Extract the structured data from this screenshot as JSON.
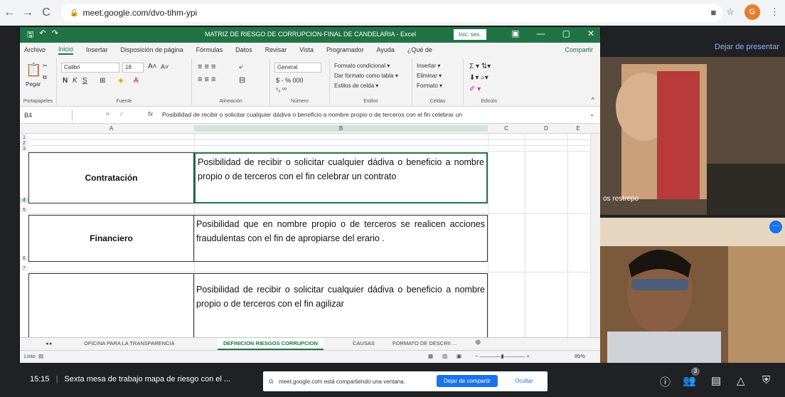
{
  "browser": {
    "url": "meet.google.com/dvo-tihm-ypi",
    "avatar_letter": "G"
  },
  "excel": {
    "title": "MATRIZ DE RIESGO DE CORRUPCION-FINAL DE CANDELARIA  -  Excel",
    "signin": "Inic. ses.",
    "tabs": [
      "Archivo",
      "Inicio",
      "Insertar",
      "Disposición de página",
      "Fórmulas",
      "Datos",
      "Revisar",
      "Vista",
      "Programador",
      "Ayuda",
      "¿Qué de",
      "Compartir"
    ],
    "ribbon": {
      "paste": "Pegar",
      "font_name": "Calibri",
      "font_size": "18",
      "number_format": "General",
      "cond_format": "Formato condicional",
      "table_format": "Dar formato como tabla",
      "cell_styles": "Estilos de celda",
      "insert": "Insertar",
      "delete": "Eliminar",
      "format": "Formato",
      "groups": [
        "Portapapeles",
        "Fuente",
        "Alineación",
        "Número",
        "Estilos",
        "Celdas",
        "Edición"
      ]
    },
    "namebox": "B4",
    "formula": "Posibilidad de recibir o solicitar cualquier dádiva o beneficio a nombre propio o de terceros con el fin celebrar un",
    "columns": [
      "A",
      "B",
      "C",
      "D",
      "E"
    ],
    "rows": [
      {
        "num": "4",
        "a": "Contratación",
        "b": "Posibilidad de recibir o solicitar cualquier dádiva o beneficio a nombre propio o de terceros con el fin celebrar un contrato"
      },
      {
        "num": "6",
        "a": "Financiero",
        "b": "Posibilidad que  en nombre propio o de terceros se realicen acciones fraudulentas con el fin de apropiarse del erario ."
      },
      {
        "num": "",
        "a": "",
        "b": "Posibilidad de recibir o solicitar cualquier dádiva o beneficio a nombre propio o de terceros con el fin agilizar"
      }
    ],
    "sheet_tabs": [
      "OFICINA PARA LA TRANSPARENCIA",
      "DEFINICION RIESGOS CORRUPCION",
      "CAUSAS",
      "FORMATO DE DESCRII ..."
    ],
    "status_ready": "Listo",
    "zoom": "85%"
  },
  "meet": {
    "present_button": "Dejar de presentar",
    "participant1_name": "os restrepo",
    "participant_count": "3",
    "time": "15:15",
    "meeting_title": "Sexta mesa de trabajo mapa de riesgo con el ...",
    "share_notice": "meet.google.com está compartiendo una ventana.",
    "stop_share": "Dejar de compartir",
    "hide": "Ocultar"
  },
  "colors": {
    "excel_green": "#217346",
    "meet_dark": "#202124",
    "link_blue": "#1a73e8"
  }
}
